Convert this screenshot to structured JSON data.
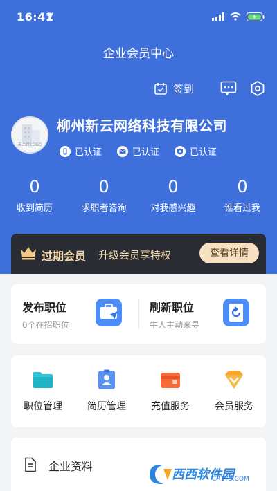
{
  "status_bar": {
    "time": "16:41"
  },
  "header": {
    "title": "企业会员中心",
    "signin_label": "签到",
    "company_name": "柳州新云网络科技有限公司",
    "avatar_text": "未上传LOGO",
    "certs": [
      {
        "icon": "phone-icon",
        "label": "已认证"
      },
      {
        "icon": "mail-icon",
        "label": "已认证"
      },
      {
        "icon": "license-icon",
        "label": "已认证"
      }
    ],
    "stats": [
      {
        "value": "0",
        "label": "收到简历"
      },
      {
        "value": "0",
        "label": "求职者咨询"
      },
      {
        "value": "0",
        "label": "对我感兴趣"
      },
      {
        "value": "0",
        "label": "谁看过我"
      }
    ]
  },
  "vip": {
    "status": "过期会员",
    "description": "升级会员享特权",
    "button_label": "查看详情"
  },
  "jobs": [
    {
      "title": "发布职位",
      "subtitle": "0个在招职位"
    },
    {
      "title": "刷新职位",
      "subtitle": "牛人主动来寻"
    }
  ],
  "grid": [
    {
      "icon": "folder-icon",
      "label": "职位管理"
    },
    {
      "icon": "resume-icon",
      "label": "简历管理"
    },
    {
      "icon": "wallet-icon",
      "label": "充值服务"
    },
    {
      "icon": "vip-diamond-icon",
      "label": "会员服务"
    }
  ],
  "company_section": {
    "label": "企业资料"
  },
  "watermark": {
    "brand": "西西软件园",
    "url": "CR173.COM"
  },
  "colors": {
    "header": "#3f6fdb",
    "vip_banner": "#2a2c33",
    "vip_text": "#f2d7a8",
    "accent_blue": "#3d8af7"
  }
}
